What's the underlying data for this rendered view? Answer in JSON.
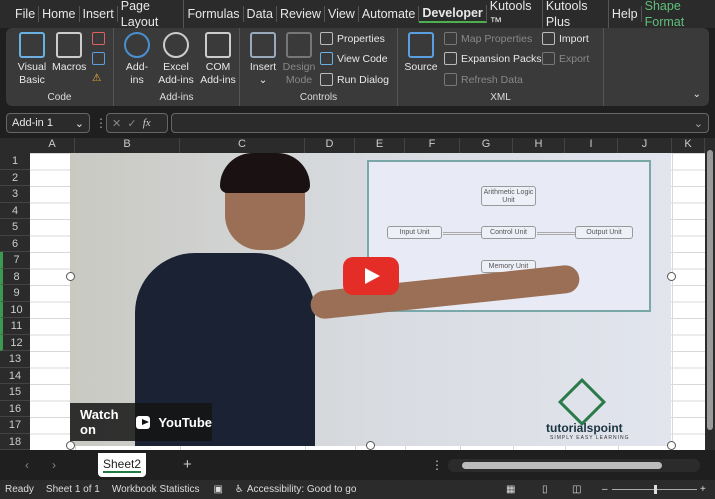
{
  "menu": [
    "File",
    "Home",
    "Insert",
    "Page Layout",
    "Formulas",
    "Data",
    "Review",
    "View",
    "Automate",
    "Developer",
    "Kutools ™",
    "Kutools Plus",
    "Help",
    "Shape Format"
  ],
  "ribbon": {
    "code": {
      "label": "Code",
      "visual_basic": "Visual Basic",
      "macros": "Macros"
    },
    "addins": {
      "label": "Add-ins",
      "addins": "Add-ins",
      "excel_addins": "Excel Add-ins",
      "com_addins": "COM Add-ins"
    },
    "controls": {
      "label": "Controls",
      "insert": "Insert",
      "design_mode": "Design Mode",
      "properties": "Properties",
      "view_code": "View Code",
      "run_dialog": "Run Dialog"
    },
    "xml": {
      "label": "XML",
      "source": "Source",
      "map_properties": "Map Properties",
      "expansion_packs": "Expansion Packs",
      "refresh_data": "Refresh Data",
      "import": "Import",
      "export": "Export"
    }
  },
  "formula_bar": {
    "name_box": "Add-in 1",
    "fx": "fx",
    "value": ""
  },
  "columns": [
    "A",
    "B",
    "C",
    "D",
    "E",
    "F",
    "G",
    "H",
    "I",
    "J",
    "K"
  ],
  "rows": [
    "1",
    "2",
    "3",
    "4",
    "5",
    "6",
    "7",
    "8",
    "9",
    "10",
    "11",
    "12",
    "13",
    "14",
    "15",
    "16",
    "17",
    "18"
  ],
  "video": {
    "watch_on": "Watch on",
    "youtube": "YouTube",
    "brand": "tutorialspoint",
    "tagline": "SIMPLY EASY LEARNING",
    "diagram": {
      "alu": "Arithmetic Logic Unit",
      "control": "Control Unit",
      "input": "Input Unit",
      "output": "Output Unit",
      "memory": "Memory Unit"
    }
  },
  "sheet_tabs": {
    "active": "Sheet2",
    "add": "+"
  },
  "status": {
    "ready": "Ready",
    "sheet": "Sheet 1 of 1",
    "stats": "Workbook Statistics",
    "accessibility": "Accessibility: Good to go"
  },
  "zoom_level": 0.5
}
